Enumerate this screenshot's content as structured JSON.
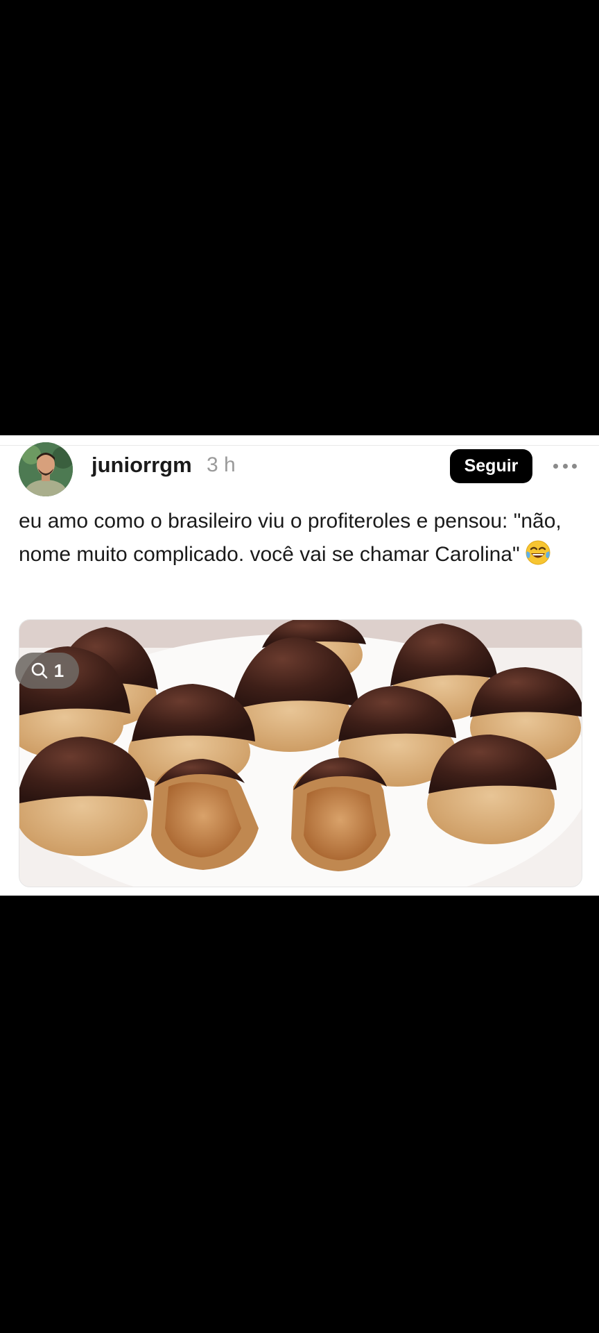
{
  "post": {
    "username": "juniorrgm",
    "time": "3 h",
    "follow_label": "Seguir",
    "text": "eu amo como o brasileiro viu o profiteroles e pensou: \"não, nome muito complicado. você vai se chamar Carolina\"",
    "emoji": "face-with-tears-of-joy",
    "image_alt": "profiteroles cobertos de chocolate recheados de doce de leite",
    "comment_count": "1"
  },
  "colors": {
    "background": "#000000",
    "card": "#ffffff",
    "button": "#000000",
    "muted": "#9a9a9a"
  }
}
